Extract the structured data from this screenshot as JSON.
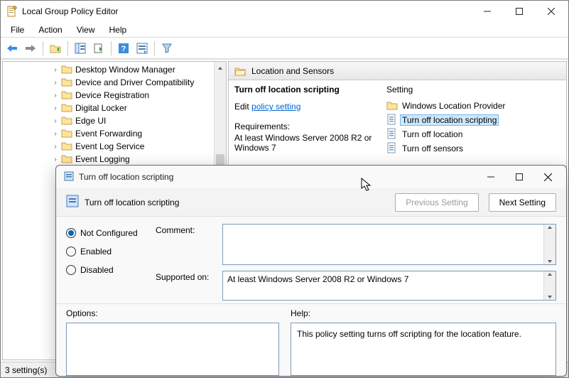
{
  "main_window": {
    "title": "Local Group Policy Editor",
    "menu": [
      "File",
      "Action",
      "View",
      "Help"
    ],
    "status": "3 setting(s)"
  },
  "tree_items": [
    "Desktop Window Manager",
    "Device and Driver Compatibility",
    "Device Registration",
    "Digital Locker",
    "Edge UI",
    "Event Forwarding",
    "Event Log Service",
    "Event Logging"
  ],
  "right": {
    "path_title": "Location and Sensors",
    "setting_name": "Turn off location scripting",
    "edit_prefix": "Edit ",
    "edit_link": "policy setting",
    "req_label": "Requirements:",
    "req_text": "At least Windows Server 2008 R2 or Windows 7",
    "col_header": "Setting",
    "settings": [
      {
        "label": "Windows Location Provider",
        "kind": "folder"
      },
      {
        "label": "Turn off location scripting",
        "kind": "policy",
        "selected": true
      },
      {
        "label": "Turn off location",
        "kind": "policy"
      },
      {
        "label": "Turn off sensors",
        "kind": "policy"
      }
    ]
  },
  "dialog": {
    "title": "Turn off location scripting",
    "header_title": "Turn off location scripting",
    "prev_btn": "Previous Setting",
    "next_btn": "Next Setting",
    "radios": {
      "not_configured": "Not Configured",
      "enabled": "Enabled",
      "disabled": "Disabled"
    },
    "comment_label": "Comment:",
    "comment_value": "",
    "supported_label": "Supported on:",
    "supported_value": "At least Windows Server 2008 R2 or Windows 7",
    "options_label": "Options:",
    "help_label": "Help:",
    "help_text": "This policy setting turns off scripting for the location feature."
  }
}
